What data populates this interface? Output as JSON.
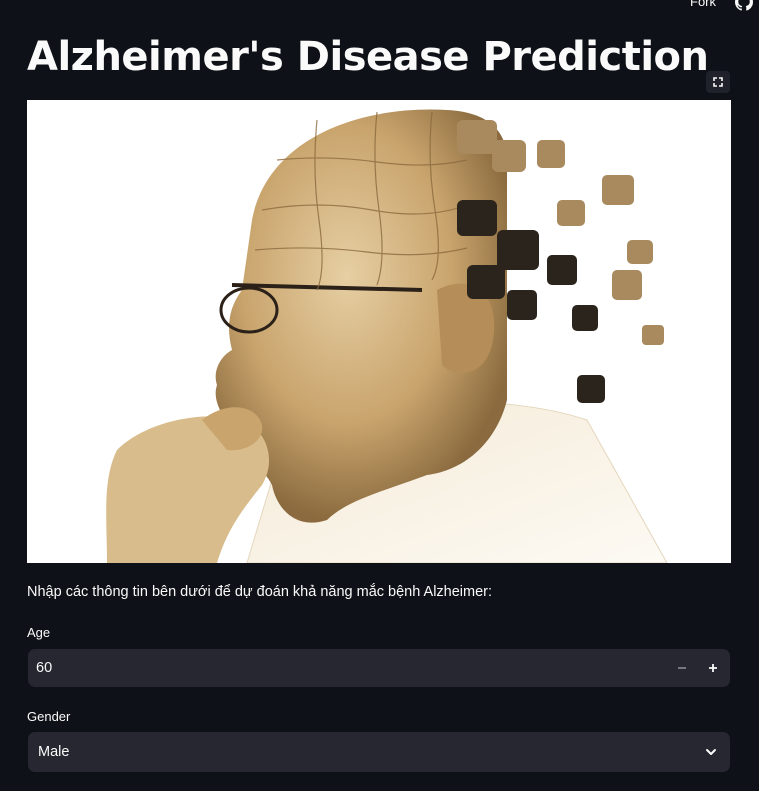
{
  "topbar": {
    "fork_label": "Fork"
  },
  "header": {
    "title": "Alzheimer's Disease Prediction"
  },
  "intro": {
    "text": "Nhập các thông tin bên dưới để dự đoán khả năng mắc bệnh Alzheimer:"
  },
  "form": {
    "age": {
      "label": "Age",
      "value": "60"
    },
    "gender": {
      "label": "Gender",
      "value": "Male"
    }
  },
  "colors": {
    "background": "#0e1117",
    "input_bg": "#262730",
    "text": "#fafafa"
  },
  "icons": [
    "github-icon",
    "fullscreen-icon",
    "minus-icon",
    "plus-icon",
    "chevron-down-icon"
  ]
}
